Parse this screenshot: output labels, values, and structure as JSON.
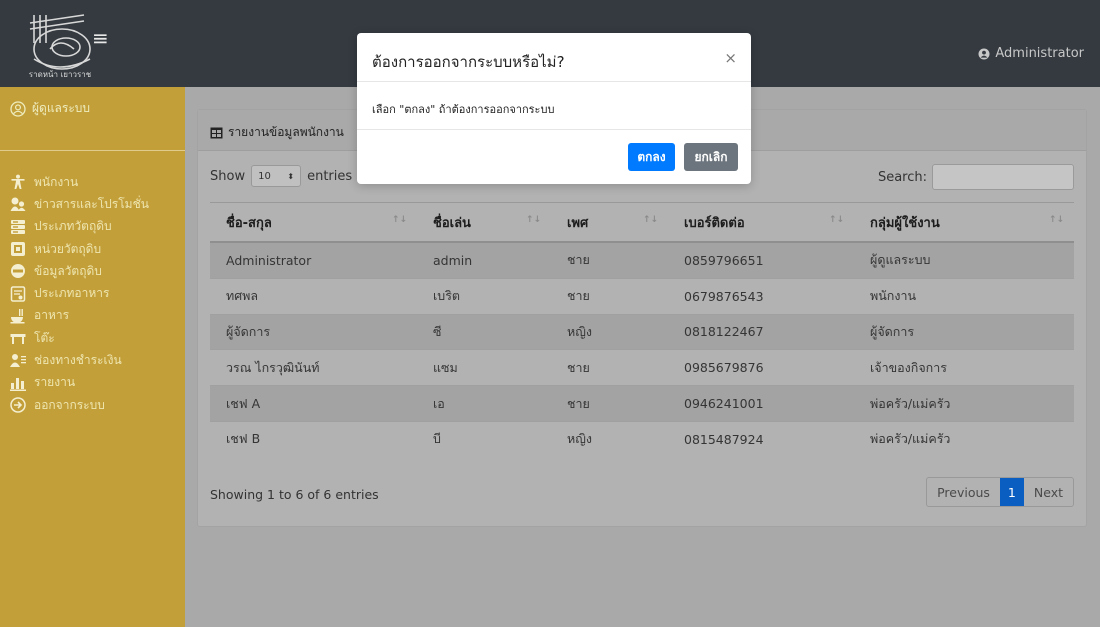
{
  "header": {
    "admin_label": "Administrator",
    "logo_caption": "ราดหน้า เยาวราช"
  },
  "sidebar": {
    "user_label": "ผู้ดูแลระบบ",
    "items": [
      {
        "label": "พนักงาน",
        "icon": "person-icon"
      },
      {
        "label": "ข่าวสารและโปรโมชั่น",
        "icon": "news-icon"
      },
      {
        "label": "ประเภทวัตถุดิบ",
        "icon": "category-icon"
      },
      {
        "label": "หน่วยวัตถุดิบ",
        "icon": "unit-icon"
      },
      {
        "label": "ข้อมูลวัตถุดิบ",
        "icon": "database-icon"
      },
      {
        "label": "ประเภทอาหาร",
        "icon": "food-type-icon"
      },
      {
        "label": "อาหาร",
        "icon": "food-icon"
      },
      {
        "label": "โต๊ะ",
        "icon": "table-icon"
      },
      {
        "label": "ช่องทางชำระเงิน",
        "icon": "payment-icon"
      },
      {
        "label": "รายงาน",
        "icon": "chart-icon"
      },
      {
        "label": "ออกจากระบบ",
        "icon": "logout-icon"
      }
    ]
  },
  "card": {
    "title": "รายงานข้อมูลพนักงาน",
    "show_label": "Show",
    "entries_label": "entries",
    "length_value": "10",
    "search_label": "Search:",
    "search_value": ""
  },
  "table": {
    "headers": [
      "ชื่อ-สกุล",
      "ชื่อเล่น",
      "เพศ",
      "เบอร์ติดต่อ",
      "กลุ่มผู้ใช้งาน"
    ],
    "rows": [
      [
        "Administrator",
        "admin",
        "ชาย",
        "0859796651",
        "ผู้ดูแลระบบ"
      ],
      [
        "ทศพล",
        "เบริต",
        "ชาย",
        "0679876543",
        "พนักงาน"
      ],
      [
        "ผู้จัดการ",
        "ซี",
        "หญิง",
        "0818122467",
        "ผู้จัดการ"
      ],
      [
        "วรณ ไกรวุฒินันท์",
        "แซม",
        "ชาย",
        "0985679876",
        "เจ้าของกิจการ"
      ],
      [
        "เชฟ A",
        "เอ",
        "ชาย",
        "0946241001",
        "พ่อครัว/แม่ครัว"
      ],
      [
        "เชฟ B",
        "บี",
        "หญิง",
        "0815487924",
        "พ่อครัว/แม่ครัว"
      ]
    ],
    "info": "Showing 1 to 6 of 6 entries",
    "pager": {
      "previous": "Previous",
      "page": "1",
      "next": "Next"
    }
  },
  "modal": {
    "title": "ต้องการออกจากระบบหรือไม่?",
    "close": "×",
    "body": "เลือก \"ตกลง\" ถ้าต้องการออกจากระบบ",
    "ok_label": "ตกลง",
    "cancel_label": "ยกเลิก"
  },
  "colors": {
    "sidebar": "#c39f3a",
    "topbar": "#343a40",
    "primary": "#007bff",
    "secondary": "#6c757d"
  }
}
